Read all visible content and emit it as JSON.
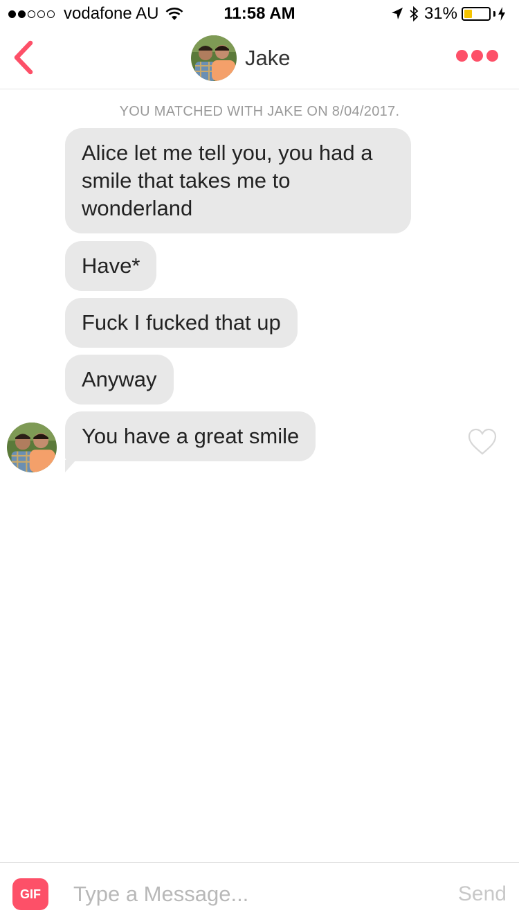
{
  "status_bar": {
    "carrier": "vodafone AU",
    "time": "11:58 AM",
    "battery_percent": "31%",
    "battery_level": 0.31,
    "signal_bars_filled": 2,
    "signal_bars_total": 5,
    "icons": [
      "wifi-icon",
      "location-arrow-icon",
      "bluetooth-icon",
      "battery-icon",
      "charging-bolt-icon"
    ]
  },
  "header": {
    "name": "Jake",
    "back_icon": "chevron-left-icon",
    "more_icon": "more-dots-icon",
    "accent_color": "#fd5068"
  },
  "conversation": {
    "match_note": "YOU MATCHED WITH JAKE ON 8/04/2017.",
    "messages": [
      {
        "text": "Alice let me tell you, you had a smile that takes me to wonderland"
      },
      {
        "text": "Have*"
      },
      {
        "text": "Fuck I fucked that up"
      },
      {
        "text": "Anyway"
      },
      {
        "text": "You have a great smile"
      }
    ],
    "like_icon": "heart-outline-icon"
  },
  "composer": {
    "gif_label": "GIF",
    "placeholder": "Type a Message...",
    "value": "",
    "send_label": "Send"
  }
}
